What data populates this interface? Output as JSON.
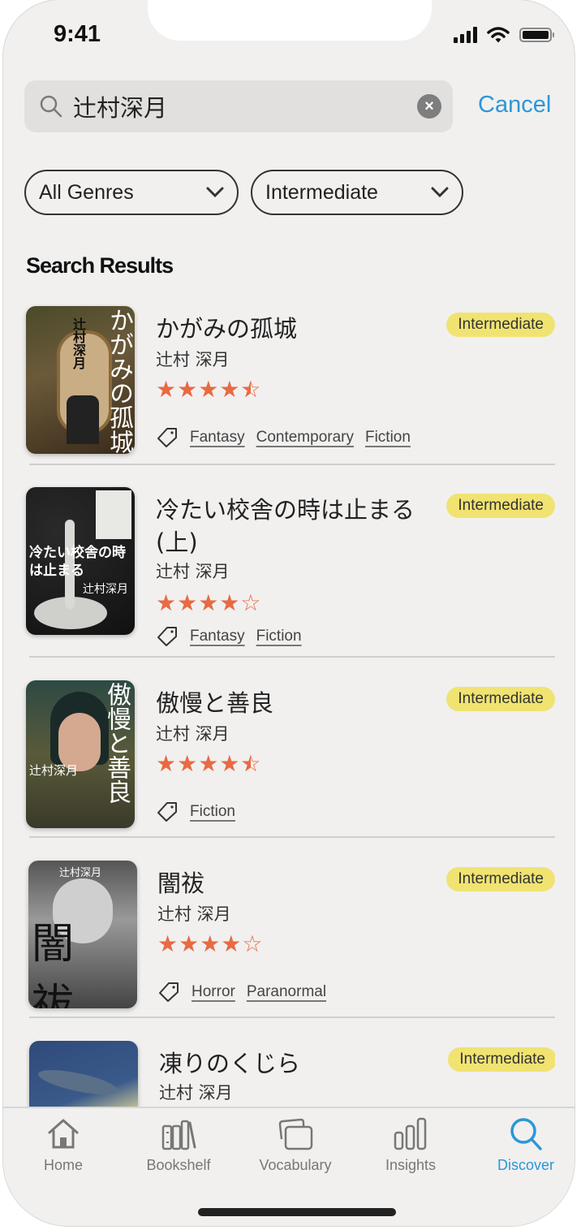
{
  "status_bar": {
    "time": "9:41"
  },
  "search": {
    "query": "辻村深月",
    "clear_icon": "clear-icon",
    "cancel_label": "Cancel"
  },
  "filters": [
    {
      "label": "All Genres"
    },
    {
      "label": "Intermediate"
    }
  ],
  "section_title": "Search Results",
  "results": [
    {
      "title": "かがみの孤城",
      "author": "辻村 深月",
      "rating": 4.5,
      "stars": "★★★★",
      "level": "Intermediate",
      "tags": [
        "Fantasy",
        "Contemporary",
        "Fiction"
      ],
      "cover_text": "かがみの孤城",
      "cover_author": "辻村深月"
    },
    {
      "title": "冷たい校舎の時は止まる(上)",
      "author": "辻村 深月",
      "rating": 4,
      "stars": "★★★★☆",
      "level": "Intermediate",
      "tags": [
        "Fantasy",
        "Fiction"
      ],
      "cover_text": "冷たい校舎の時は止まる",
      "cover_author": "辻村深月"
    },
    {
      "title": "傲慢と善良",
      "author": "辻村 深月",
      "rating": 4.5,
      "stars": "★★★★",
      "level": "Intermediate",
      "tags": [
        "Fiction"
      ],
      "cover_text": "傲慢と善良",
      "cover_author": "辻村深月"
    },
    {
      "title": "闇祓",
      "author": "辻村 深月",
      "rating": 4,
      "stars": "★★★★☆",
      "level": "Intermediate",
      "tags": [
        "Horror",
        "Paranormal"
      ],
      "cover_text": "闇祓",
      "cover_author": "辻村深月"
    },
    {
      "title": "凍りのくじら",
      "author": "辻村 深月",
      "level": "Intermediate"
    }
  ],
  "tabbar": [
    {
      "label": "Home",
      "icon": "home-icon"
    },
    {
      "label": "Bookshelf",
      "icon": "bookshelf-icon"
    },
    {
      "label": "Vocabulary",
      "icon": "cards-icon"
    },
    {
      "label": "Insights",
      "icon": "bar-chart-icon"
    },
    {
      "label": "Discover",
      "icon": "search-icon",
      "active": true
    }
  ],
  "colors": {
    "accent": "#2b97d6",
    "star": "#e86a43",
    "badge": "#f0e371",
    "background": "#f1f0ef"
  }
}
